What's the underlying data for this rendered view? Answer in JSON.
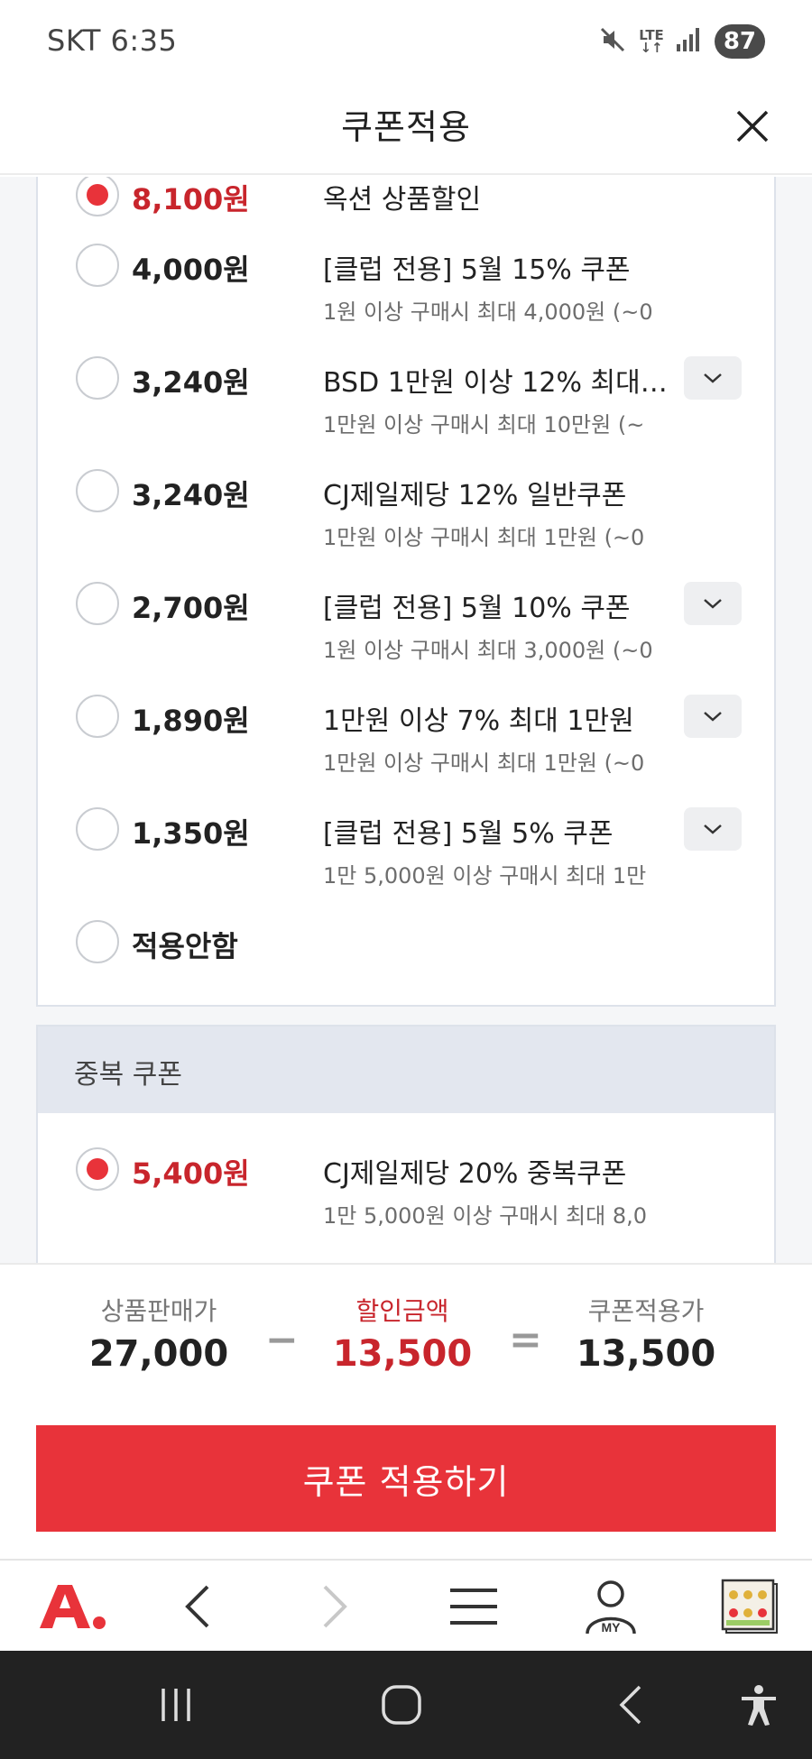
{
  "status": {
    "carrier_time": "SKT 6:35",
    "network": "LTE",
    "battery": "87",
    "icons": [
      "mute-icon",
      "lte-icon",
      "signal-icon",
      "battery-icon"
    ]
  },
  "header": {
    "title": "쿠폰적용",
    "close_icon": "close-icon"
  },
  "coupons": [
    {
      "amount": "8,100원",
      "name": "옥션 상품할인",
      "desc": "",
      "selected": true,
      "expand": false
    },
    {
      "amount": "4,000원",
      "name": "[클럽 전용] 5월 15% 쿠폰",
      "desc": "1원 이상 구매시 최대 4,000원 (~0",
      "selected": false,
      "expand": false
    },
    {
      "amount": "3,240원",
      "name": "BSD 1만원 이상 12% 최대 1...",
      "desc": "1만원 이상 구매시 최대 10만원 (~",
      "selected": false,
      "expand": true
    },
    {
      "amount": "3,240원",
      "name": "CJ제일제당 12% 일반쿠폰",
      "desc": "1만원 이상 구매시 최대 1만원 (~0",
      "selected": false,
      "expand": false
    },
    {
      "amount": "2,700원",
      "name": "[클럽 전용] 5월 10% 쿠폰",
      "desc": "1원 이상 구매시 최대 3,000원 (~0",
      "selected": false,
      "expand": true
    },
    {
      "amount": "1,890원",
      "name": "1만원 이상 7% 최대 1만원",
      "desc": "1만원 이상 구매시 최대 1만원 (~0",
      "selected": false,
      "expand": true
    },
    {
      "amount": "1,350원",
      "name": "[클럽 전용] 5월 5% 쿠폰",
      "desc": "1만 5,000원 이상 구매시 최대 1만",
      "selected": false,
      "expand": true
    },
    {
      "amount": "적용안함",
      "name": "",
      "desc": "",
      "selected": false,
      "expand": false
    }
  ],
  "duplicate": {
    "title": "중복 쿠폰",
    "items": [
      {
        "amount": "5,400원",
        "name": "CJ제일제당 20% 중복쿠폰",
        "desc": "1만 5,000원 이상 구매시 최대 8,0",
        "selected": true
      }
    ]
  },
  "summary": {
    "price_label": "상품판매가",
    "price_value": "27,000",
    "minus": "−",
    "discount_label": "할인금액",
    "discount_value": "13,500",
    "equals": "=",
    "final_label": "쿠폰적용가",
    "final_value": "13,500"
  },
  "apply_button": "쿠폰 적용하기",
  "browser_bar": {
    "items": [
      "auction-logo",
      "back-arrow-icon",
      "forward-arrow-icon",
      "menu-icon",
      "my-icon",
      "tabs-thumbnail"
    ],
    "my_label": "MY"
  },
  "android_nav": [
    "recents-icon",
    "home-icon",
    "back-icon",
    "accessibility-icon"
  ],
  "colors": {
    "accent_red": "#e8333a",
    "amount_red": "#c8252c",
    "dup_header_bg": "#e3e7ef"
  }
}
